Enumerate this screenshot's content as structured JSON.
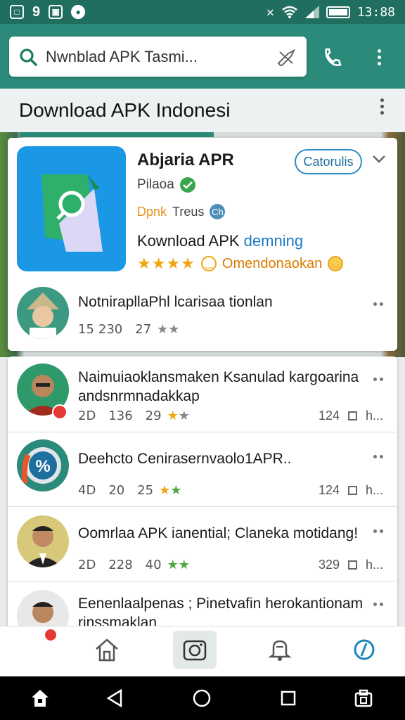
{
  "status_bar": {
    "time": "13:88"
  },
  "search": {
    "value": "Nwnblad APK Tasmi..."
  },
  "page": {
    "title": "Download APK Indonesi"
  },
  "app": {
    "name": "Abjaria APR",
    "publisher": "Pilaoa",
    "tag1": "Dpnk",
    "tag2": "Treus",
    "tag3": "Ch",
    "action": "Catorulis",
    "download_prefix": "Kownload APK",
    "download_accent": "demning",
    "rating_text": "Omendonaokan",
    "stars": "★★★★"
  },
  "comments": [
    {
      "text": "NotnirapllaPhl lcarisaa tionlan",
      "a": "15",
      "b": "230",
      "c": "27",
      "stars": "★★"
    }
  ],
  "list": [
    {
      "text": "Naimuiaoklansmaken Ksanulad kargoarina andsnrmnadakkap",
      "a": "2D",
      "b": "136",
      "c": "29",
      "stars1": "★",
      "stars2": "★",
      "count": "124",
      "more": "h..."
    },
    {
      "text": "Deehcto Cenirasernvaolo1APR..",
      "a": "4D",
      "b": "20",
      "c": "25",
      "stars1": "★",
      "stars2": "★",
      "count": "124",
      "more": "h..."
    },
    {
      "text": "Oomrlaa APK ianential; Claneka motidang!",
      "a": "2D",
      "b": "228",
      "c": "40",
      "stars1": "★",
      "stars2": "★",
      "count": "329",
      "more": "h..."
    },
    {
      "text": "Eenenlaalpenas ; Pinetvafin herokantionam rinssmaklan",
      "a": "",
      "b": "",
      "c": "",
      "stars1": "",
      "stars2": "",
      "count": "",
      "more": ""
    }
  ],
  "colors": {
    "primary": "#2b8a79",
    "status": "#1f6e60",
    "accent_blue": "#1d7ac5",
    "star": "#f1a510"
  }
}
